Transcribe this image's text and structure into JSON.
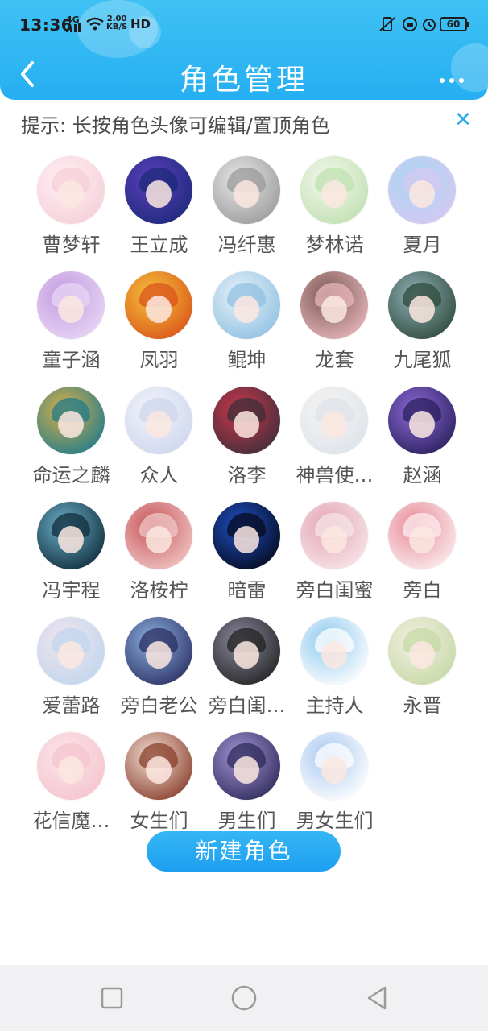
{
  "status_bar": {
    "time": "13:36",
    "network": "4G",
    "net_speed_value": "2.00",
    "net_speed_unit": "KB/S",
    "hd": "HD",
    "battery": "60"
  },
  "header": {
    "title": "角色管理",
    "back_icon": "chevron-left-icon",
    "more_icon": "more-dots-icon"
  },
  "tip": {
    "text": "提示: 长按角色头像可编辑/置顶角色",
    "close_icon": "close-icon"
  },
  "roles": [
    {
      "name": "曹梦轩",
      "colors": [
        "#f6cfd8",
        "#fff0f4"
      ]
    },
    {
      "name": "王立成",
      "colors": [
        "#1c2a78",
        "#5b3fbf"
      ]
    },
    {
      "name": "冯纤惠",
      "colors": [
        "#9a9a9a",
        "#e8e8e8"
      ]
    },
    {
      "name": "梦林诺",
      "colors": [
        "#bfe0b0",
        "#f4f8ee"
      ]
    },
    {
      "name": "夏月",
      "colors": [
        "#d6c8f2",
        "#a8d6f2"
      ]
    },
    {
      "name": "童子涵",
      "colors": [
        "#e7d7f5",
        "#c49be0"
      ]
    },
    {
      "name": "凤羽",
      "colors": [
        "#d9531b",
        "#f6c43a"
      ]
    },
    {
      "name": "鲲坤",
      "colors": [
        "#8fc0e2",
        "#e8f2f8"
      ]
    },
    {
      "name": "龙套",
      "colors": [
        "#e8b6bd",
        "#7a5a52"
      ]
    },
    {
      "name": "九尾狐",
      "colors": [
        "#2e4a3a",
        "#8fb0b8"
      ]
    },
    {
      "name": "命运之麟",
      "colors": [
        "#1f7b8a",
        "#d8b04a"
      ]
    },
    {
      "name": "众人",
      "colors": [
        "#cdd6ee",
        "#f3f4fa"
      ]
    },
    {
      "name": "洛李",
      "colors": [
        "#3e2e3a",
        "#c9374b"
      ]
    },
    {
      "name": "神兽使…",
      "colors": [
        "#dde3ea",
        "#f6f4f2"
      ]
    },
    {
      "name": "赵涵",
      "colors": [
        "#2a1f5c",
        "#8c6ad8"
      ]
    },
    {
      "name": "冯宇程",
      "colors": [
        "#0f2b3a",
        "#6bb0c9"
      ]
    },
    {
      "name": "洛桉柠",
      "colors": [
        "#f0c7c5",
        "#c7555a"
      ]
    },
    {
      "name": "暗雷",
      "colors": [
        "#050a1c",
        "#1f4fc4"
      ]
    },
    {
      "name": "旁白闺蜜",
      "colors": [
        "#f6e6ea",
        "#e5a5b3"
      ]
    },
    {
      "name": "旁白",
      "colors": [
        "#fbeef0",
        "#e88a98"
      ]
    },
    {
      "name": "爱蕾路",
      "colors": [
        "#bfd6ef",
        "#f2e4ec"
      ]
    },
    {
      "name": "旁白老公",
      "colors": [
        "#2b2f62",
        "#8ab0e0"
      ]
    },
    {
      "name": "旁白闺…",
      "colors": [
        "#222222",
        "#8a8aa0"
      ]
    },
    {
      "name": "主持人",
      "colors": [
        "#ffffff",
        "#8fcaef"
      ]
    },
    {
      "name": "永晋",
      "colors": [
        "#c6d9a6",
        "#f3efe2"
      ]
    },
    {
      "name": "花信魔…",
      "colors": [
        "#f5c4cf",
        "#fbe4e8"
      ]
    },
    {
      "name": "女生们",
      "colors": [
        "#8a3d2b",
        "#f2e1d6"
      ]
    },
    {
      "name": "男生们",
      "colors": [
        "#2e2a5a",
        "#a495d6"
      ]
    },
    {
      "name": "男女生们",
      "colors": [
        "#ffffff",
        "#a9c8f0"
      ]
    }
  ],
  "new_role_button": "新建角色",
  "nav_bar": {
    "recent_icon": "square-icon",
    "home_icon": "circle-icon",
    "back_icon": "triangle-back-icon"
  },
  "colors": {
    "header": "#2aaef2",
    "accent": "#2aa9ef",
    "text": "#555555"
  }
}
